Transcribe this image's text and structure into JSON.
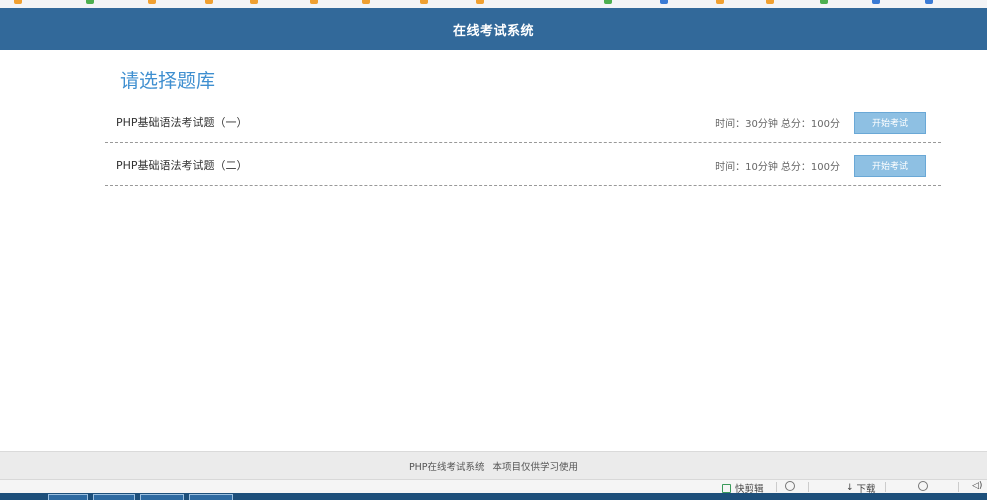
{
  "app": {
    "title": "在线考试系统"
  },
  "main": {
    "heading": "请选择题库",
    "exams": [
      {
        "name": "PHP基础语法考试题（一）",
        "time": "时间：30分钟",
        "score": "总分：100分",
        "button": "开始考试"
      },
      {
        "name": "PHP基础语法考试题（二）",
        "time": "时间：10分钟",
        "score": "总分：100分",
        "button": "开始考试"
      }
    ]
  },
  "footer": {
    "site_name": "PHP在线考试系统",
    "notice": "本项目仅供学习使用"
  },
  "statusbar": {
    "snip_label": "快剪辑",
    "download_label": "下载"
  },
  "colors": {
    "header_bg": "#32699a",
    "heading": "#3f8fd0",
    "button_bg": "#8ec0e3"
  },
  "icons": [
    "bookmark-icon",
    "snip-icon",
    "download-icon",
    "refresh-icon",
    "volume-icon"
  ]
}
